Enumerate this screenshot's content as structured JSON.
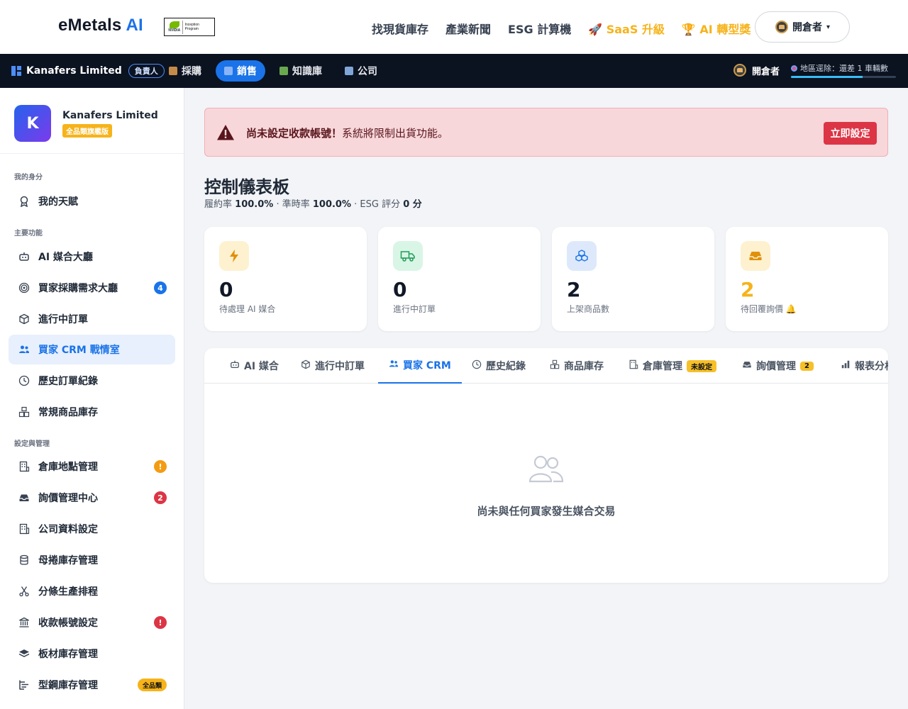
{
  "header": {
    "brand_main": "eMetals",
    "brand_ai": "AI",
    "badge_nvidia": "NVIDIA",
    "badge_program": "Inception Program",
    "nav": [
      {
        "label": "找現貨庫存"
      },
      {
        "label": "產業新聞"
      },
      {
        "label": "ESG 計算機"
      },
      {
        "label": "🚀 SaaS 升級"
      },
      {
        "label": "🏆 AI 轉型獎"
      }
    ],
    "user": "開倉者"
  },
  "darknav": {
    "company": "Kanafers Limited",
    "role": "負責人",
    "tabs": [
      {
        "label": "採購"
      },
      {
        "label": "銷售"
      },
      {
        "label": "知識庫"
      },
      {
        "label": "公司"
      }
    ],
    "user": "開倉者",
    "status": "地區逕除：還差 1 車輛數",
    "progress": 0.68
  },
  "sidebar": {
    "company_initial": "K",
    "company_name": "Kanafers Limited",
    "plan": "全品類旗艦版",
    "sections": [
      "我的身分",
      "主要功能",
      "設定與管理"
    ],
    "items": [
      {
        "label": "我的天賦"
      },
      {
        "label": "AI 媒合大廳"
      },
      {
        "label": "買家採購需求大廳",
        "badge": "4"
      },
      {
        "label": "進行中訂單"
      },
      {
        "label": "買家 CRM 戰情室"
      },
      {
        "label": "歷史訂單紀錄"
      },
      {
        "label": "常規商品庫存"
      },
      {
        "label": "倉庫地點管理",
        "badge": "!"
      },
      {
        "label": "詢價管理中心",
        "badge": "2"
      },
      {
        "label": "公司資料設定"
      },
      {
        "label": "母捲庫存管理"
      },
      {
        "label": "分條生產排程"
      },
      {
        "label": "收款帳號設定",
        "badge": "!"
      },
      {
        "label": "板材庫存管理"
      },
      {
        "label": "型鋼庫存管理",
        "badge": "全品類"
      }
    ]
  },
  "alert": {
    "bold": "尚未設定收款帳號！",
    "text": "系統將限制出貨功能。",
    "button": "立即設定"
  },
  "dashboard": {
    "title": "控制儀表板",
    "fulfill_label": "履約率",
    "fulfill_value": "100.0%",
    "ontime_label": "· 準時率",
    "ontime_value": "100.0%",
    "esg_label": "· ESG 評分",
    "esg_value": "0 分"
  },
  "cards": [
    {
      "value": "0",
      "label": "待處理 AI 媒合",
      "icon": "lightning-icon",
      "color": "#fdf1cf"
    },
    {
      "value": "0",
      "label": "進行中訂單",
      "icon": "truck-icon",
      "color": "#d9f5e6"
    },
    {
      "value": "2",
      "label": "上架商品數",
      "icon": "boxes-icon",
      "color": "#dde9fb"
    },
    {
      "value": "2",
      "label": "待回覆詢價 🔔",
      "icon": "inbox-icon",
      "color": "#fdf1cf"
    }
  ],
  "panel": {
    "tabs": [
      {
        "label": "AI 媒合"
      },
      {
        "label": "進行中訂單"
      },
      {
        "label": "買家 CRM"
      },
      {
        "label": "歷史紀錄"
      },
      {
        "label": "商品庫存"
      },
      {
        "label": "倉庫管理",
        "badge": "未設定"
      },
      {
        "label": "詢價管理",
        "badge": "2"
      },
      {
        "label": "報表分析"
      }
    ],
    "empty_text": "尚未與任何買家發生媒合交易"
  },
  "colors": {
    "accent": "#1a73e8",
    "gold": "#f6b31a",
    "danger": "#dc3545",
    "dark_nav": "#0b1220"
  }
}
